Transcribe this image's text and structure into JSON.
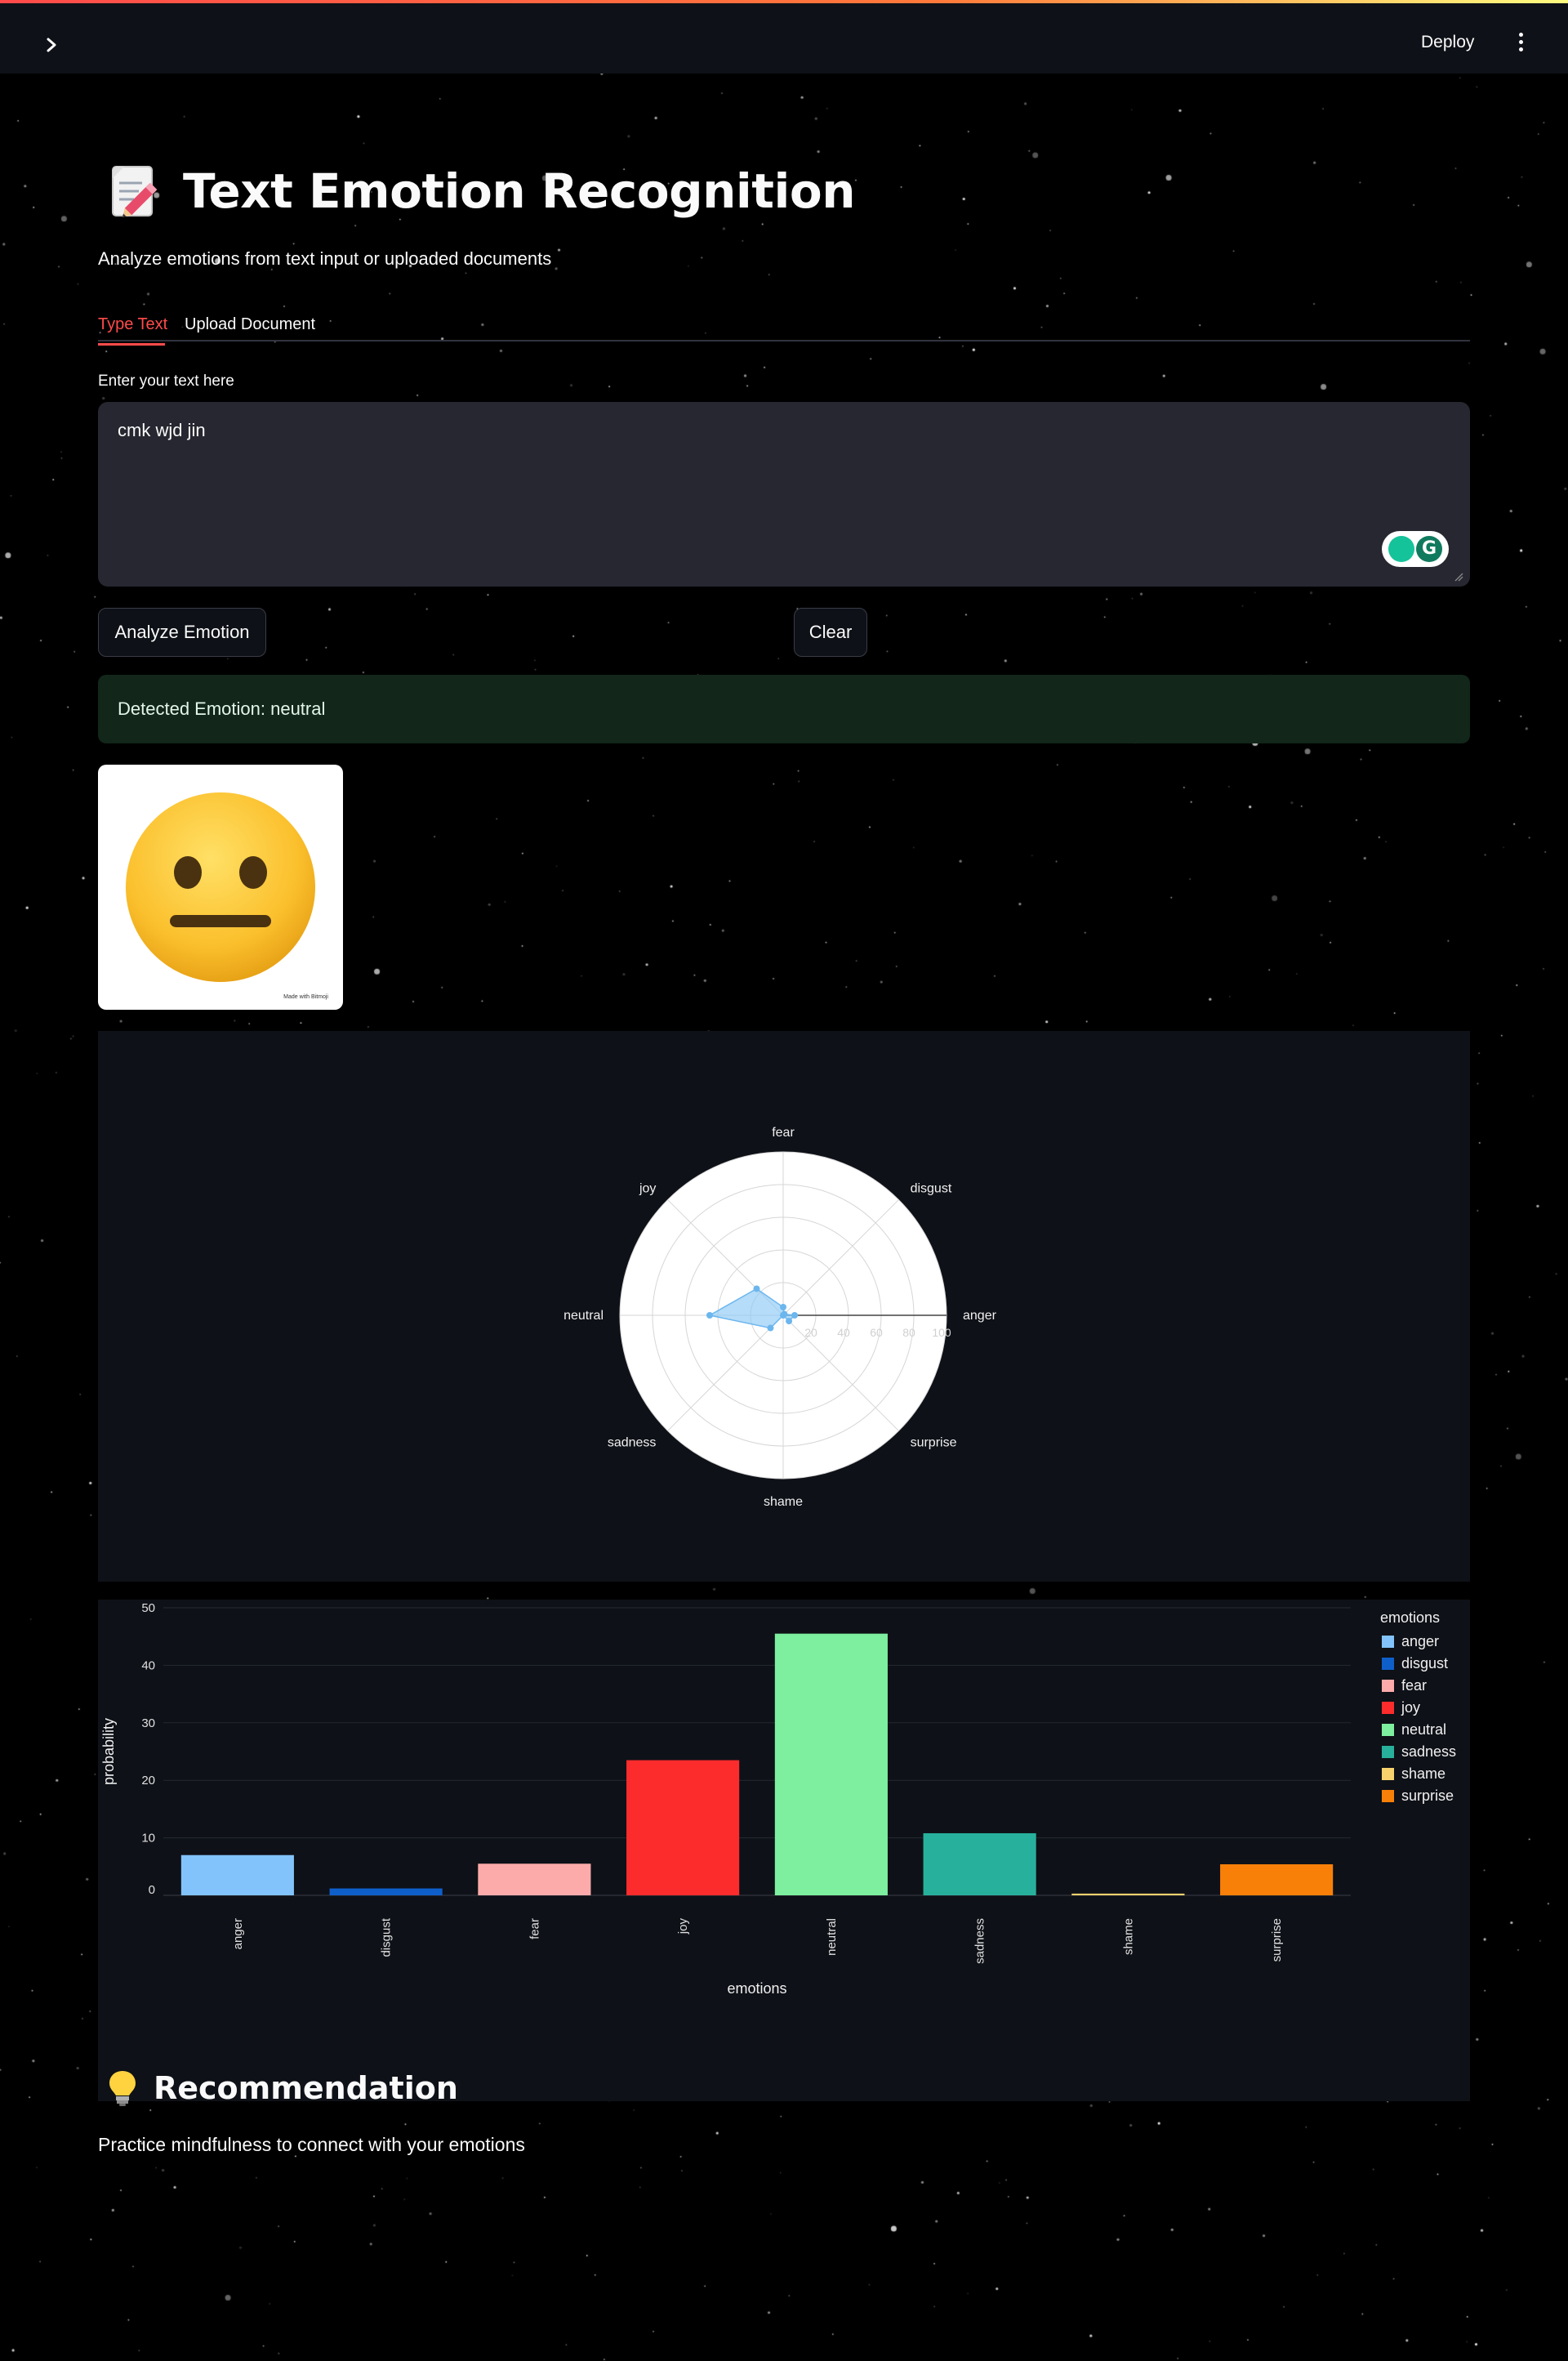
{
  "header": {
    "deploy_label": "Deploy",
    "sidebar_toggle_icon": "chevron-right-icon",
    "menu_icon": "kebab-menu-icon"
  },
  "page": {
    "title": "Text Emotion Recognition",
    "title_icon": "memo-icon",
    "subtitle": "Analyze emotions from text input or uploaded documents"
  },
  "tabs": [
    {
      "label": "Type Text",
      "active": true
    },
    {
      "label": "Upload Document",
      "active": false
    }
  ],
  "input": {
    "label": "Enter your text here",
    "value": "cmk wjd jin"
  },
  "buttons": {
    "analyze": "Analyze Emotion",
    "clear": "Clear"
  },
  "result": {
    "text": "Detected Emotion: neutral",
    "emoji": "neutral-face-emoji",
    "image_credit": "Made with Bitmoji"
  },
  "chart_data": [
    {
      "type": "radar",
      "axes": [
        "anger",
        "disgust",
        "fear",
        "joy",
        "neutral",
        "sadness",
        "shame",
        "surprise"
      ],
      "values": [
        7,
        1,
        5,
        23,
        45,
        11,
        0,
        5
      ],
      "radial_range": [
        0,
        100
      ],
      "radial_ticks": [
        "0",
        "20",
        "40",
        "60",
        "80",
        "100"
      ],
      "fill_color": "#8ec9f4"
    },
    {
      "type": "bar",
      "categories": [
        "anger",
        "disgust",
        "fear",
        "joy",
        "neutral",
        "sadness",
        "shame",
        "surprise"
      ],
      "values": [
        7,
        1.2,
        5.5,
        23.5,
        45.5,
        10.8,
        0.3,
        5.4
      ],
      "colors": [
        "#82c3fb",
        "#0f5fcb",
        "#fcabaa",
        "#fc2c2c",
        "#7def9f",
        "#27b19d",
        "#f8d26d",
        "#f98008"
      ],
      "xlabel": "emotions",
      "ylabel": "probability",
      "ylim": [
        0,
        50
      ],
      "yticks": [
        0,
        10,
        20,
        30,
        40,
        50
      ],
      "legend_title": "emotions",
      "legend_position": "top-right",
      "grid": true
    }
  ],
  "recommendation": {
    "title": "Recommendation",
    "icon": "light-bulb-icon",
    "text": "Practice mindfulness to connect with your emotions"
  }
}
